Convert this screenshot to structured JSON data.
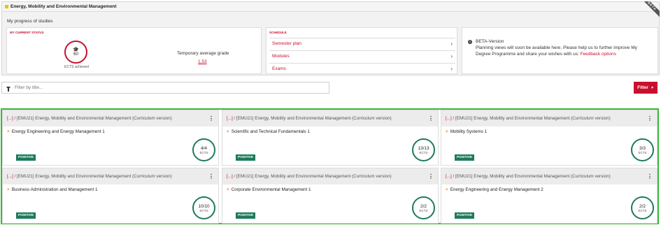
{
  "header": {
    "title": "Energy, Mobility and Environmental Management",
    "beta": "BETA"
  },
  "progress_label": "My progress of studies",
  "status": {
    "section_label": "MY CURRENT STATUS",
    "ects": "60",
    "ects_caption": "ECTS achieved",
    "grade_label": "Temporary average grade",
    "grade_value": "1,53",
    "icon": "graduation-cap-icon"
  },
  "schedule": {
    "section_label": "SCHEDULE",
    "items": [
      {
        "label": "Semester plan"
      },
      {
        "label": "Modules"
      },
      {
        "label": "Exams"
      }
    ]
  },
  "info": {
    "title": "BETA-Version",
    "text": "Planning views will soon be available here. Please help us to further improve My Degree Programme and share your wishes with us: ",
    "link": "Feedback options"
  },
  "filter": {
    "placeholder": "Filter by title...",
    "button_label": "Filter"
  },
  "modules": [
    {
      "prefix": "[...]",
      "path": " / [EMU21] Energy, Mobility and Environmental Management (Curriculum version)",
      "name": "Energy Engineering and Energy Management 1",
      "status": "POSITIVE",
      "ects": "4/4",
      "unit": "ECTS"
    },
    {
      "prefix": "[...]",
      "path": " / [EMU21] Energy, Mobility and Environmental Management (Curriculum version)",
      "name": "Scientific and Technical Fundamentals 1",
      "status": "POSITIVE",
      "ects": "13/13",
      "unit": "ECTS"
    },
    {
      "prefix": "[...]",
      "path": " / [EMU21] Energy, Mobility and Environmental Management (Curriculum version)",
      "name": "Mobility Systems 1",
      "status": "POSITIVE",
      "ects": "3/3",
      "unit": "ECTS"
    },
    {
      "prefix": "[...]",
      "path": " / [EMU21] Energy, Mobility and Environmental Management (Curriculum version)",
      "name": "Business Administration and Management 1",
      "status": "POSITIVE",
      "ects": "10/10",
      "unit": "ECTS"
    },
    {
      "prefix": "[...]",
      "path": " / [EMU21] Energy, Mobility and Environmental Management (Curriculum version)",
      "name": "Corporate Environmental Management 1",
      "status": "POSITIVE",
      "ects": "2/2",
      "unit": "ECTS"
    },
    {
      "prefix": "[...]",
      "path": " / [EMU21] Energy, Mobility and Environmental Management (Curriculum version)",
      "name": "Energy Engineering and Energy Management 2",
      "status": "POSITIVE",
      "ects": "2/2",
      "unit": "ECTS"
    }
  ],
  "colors": {
    "accent": "#c8102e",
    "positive": "#1d7a5b",
    "highlight_frame": "#3cb83c"
  }
}
